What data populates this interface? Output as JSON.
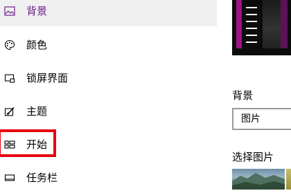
{
  "nav": {
    "items": [
      {
        "label": "背景",
        "icon": "picture-icon",
        "selected": true
      },
      {
        "label": "颜色",
        "icon": "palette-icon",
        "selected": false
      },
      {
        "label": "锁屏界面",
        "icon": "lock-screen-icon",
        "selected": false
      },
      {
        "label": "主题",
        "icon": "theme-brush-icon",
        "selected": false
      },
      {
        "label": "开始",
        "icon": "start-tiles-icon",
        "selected": false
      },
      {
        "label": "任务栏",
        "icon": "taskbar-icon",
        "selected": false
      }
    ]
  },
  "colors": {
    "accent_selected_text": "#6b1f8c",
    "highlight_box": "#e60012",
    "tile_magenta": "#a01484"
  },
  "main": {
    "background_label": "背景",
    "background_select_value": "图片",
    "choose_picture_label": "选择图片"
  }
}
